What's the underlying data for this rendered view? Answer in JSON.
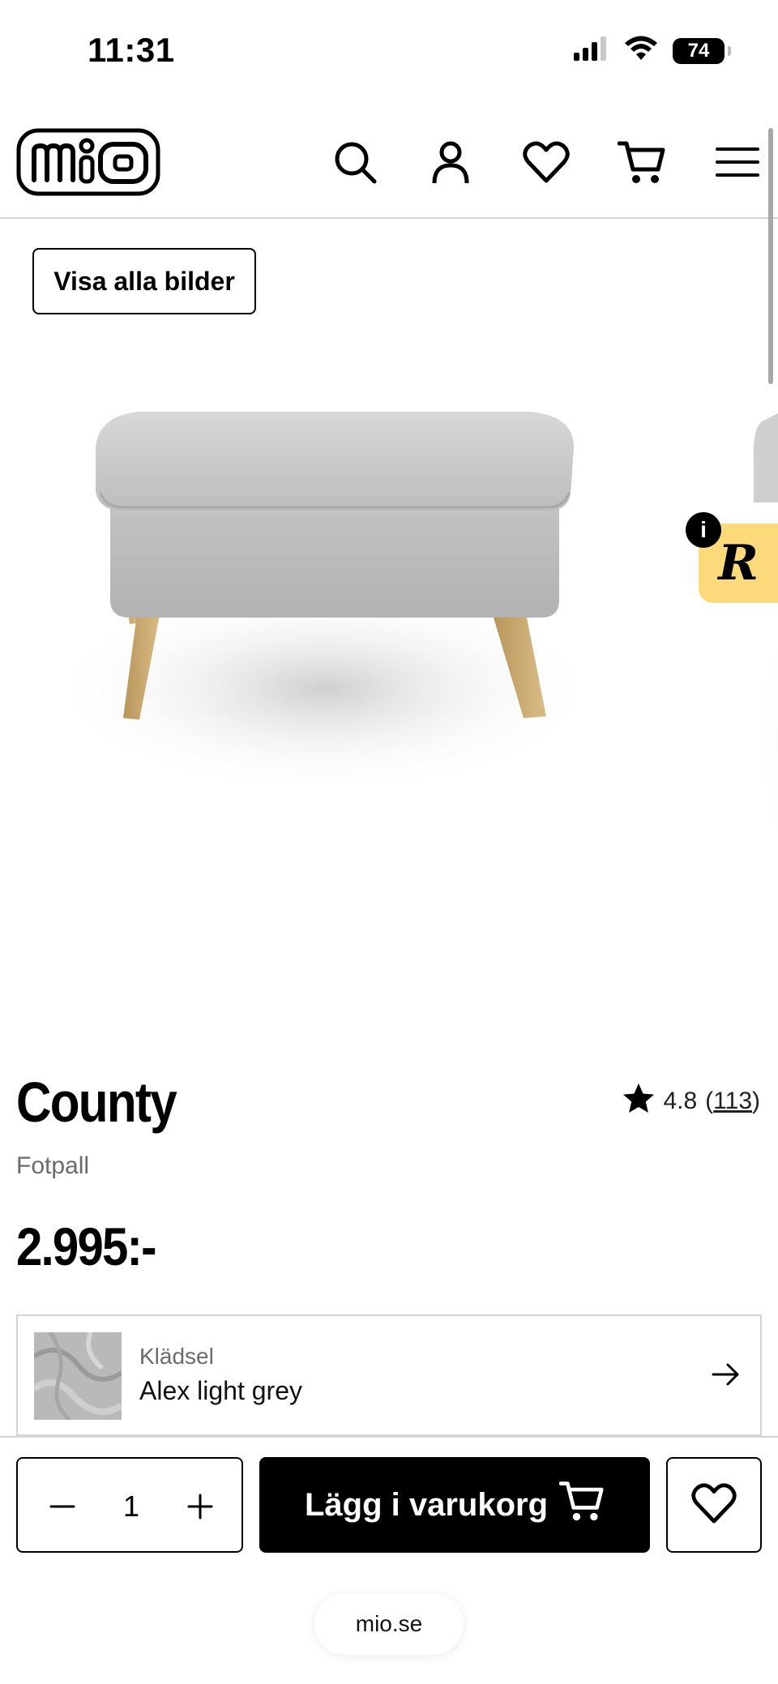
{
  "status_bar": {
    "time": "11:31",
    "battery": "74"
  },
  "header": {
    "logo_text": "mio",
    "icons": [
      "search-icon",
      "account-icon",
      "heart-icon",
      "cart-icon",
      "menu-icon"
    ]
  },
  "gallery": {
    "view_all_label": "Visa alla bilder"
  },
  "product": {
    "name": "County",
    "type": "Fotpall",
    "rating": "4.8",
    "review_count": "113",
    "price": "2.995:-"
  },
  "upholstery": {
    "label": "Klädsel",
    "value": "Alex light grey"
  },
  "actions": {
    "quantity": "1",
    "add_to_cart_label": "Lägg i varukorg"
  },
  "browser": {
    "url": "mio.se"
  },
  "colors": {
    "accent": "#000000",
    "badge": "#fcd97a",
    "muted_text": "#6b6b6b",
    "border": "#d4d4d4"
  }
}
